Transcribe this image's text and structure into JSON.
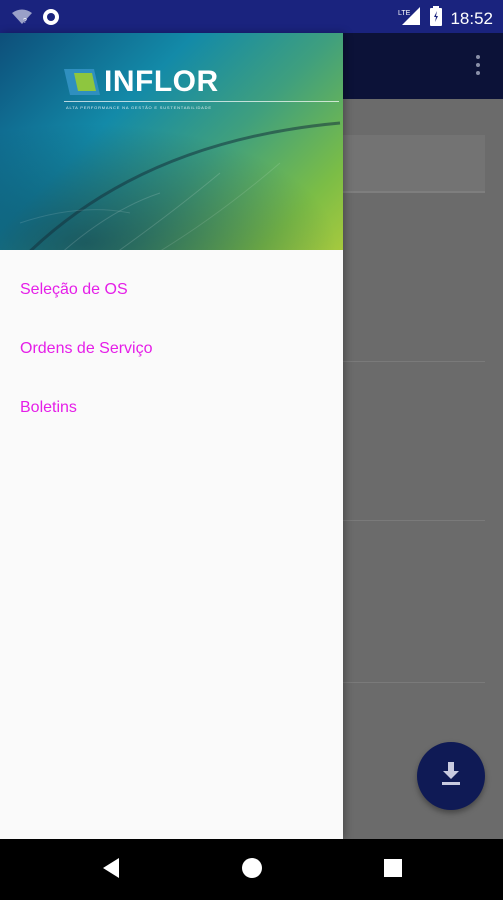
{
  "status_bar": {
    "time": "18:52",
    "icons": [
      "wifi-icon",
      "sync-icon",
      "signal-icon",
      "battery-icon"
    ],
    "network_label": "LTE"
  },
  "app": {
    "brand_color": "#1a237e",
    "fab_icon": "download-icon"
  },
  "drawer": {
    "header": {
      "logo_text": "INFLOR",
      "tagline": "ALTA PERFORMANCE NA GESTÃO E SUSTENTABILIDADE"
    },
    "items": [
      {
        "label": "Seleção de OS"
      },
      {
        "label": "Ordens de Serviço"
      },
      {
        "label": "Boletins"
      }
    ],
    "accent_color": "#e51ee8"
  },
  "nav_bar": {
    "buttons": [
      "back-icon",
      "home-icon",
      "recents-icon"
    ]
  }
}
